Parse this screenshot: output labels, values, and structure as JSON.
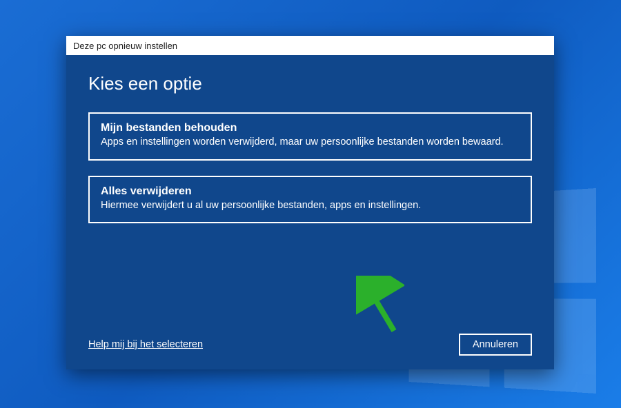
{
  "dialog": {
    "title": "Deze pc opnieuw instellen",
    "heading": "Kies een optie",
    "options": [
      {
        "title": "Mijn bestanden behouden",
        "description": "Apps en instellingen worden verwijderd, maar uw persoonlijke bestanden worden bewaard."
      },
      {
        "title": "Alles verwijderen",
        "description": "Hiermee verwijdert u al uw persoonlijke bestanden, apps en instellingen."
      }
    ],
    "helpLink": "Help mij bij het selecteren",
    "cancelButton": "Annuleren"
  }
}
